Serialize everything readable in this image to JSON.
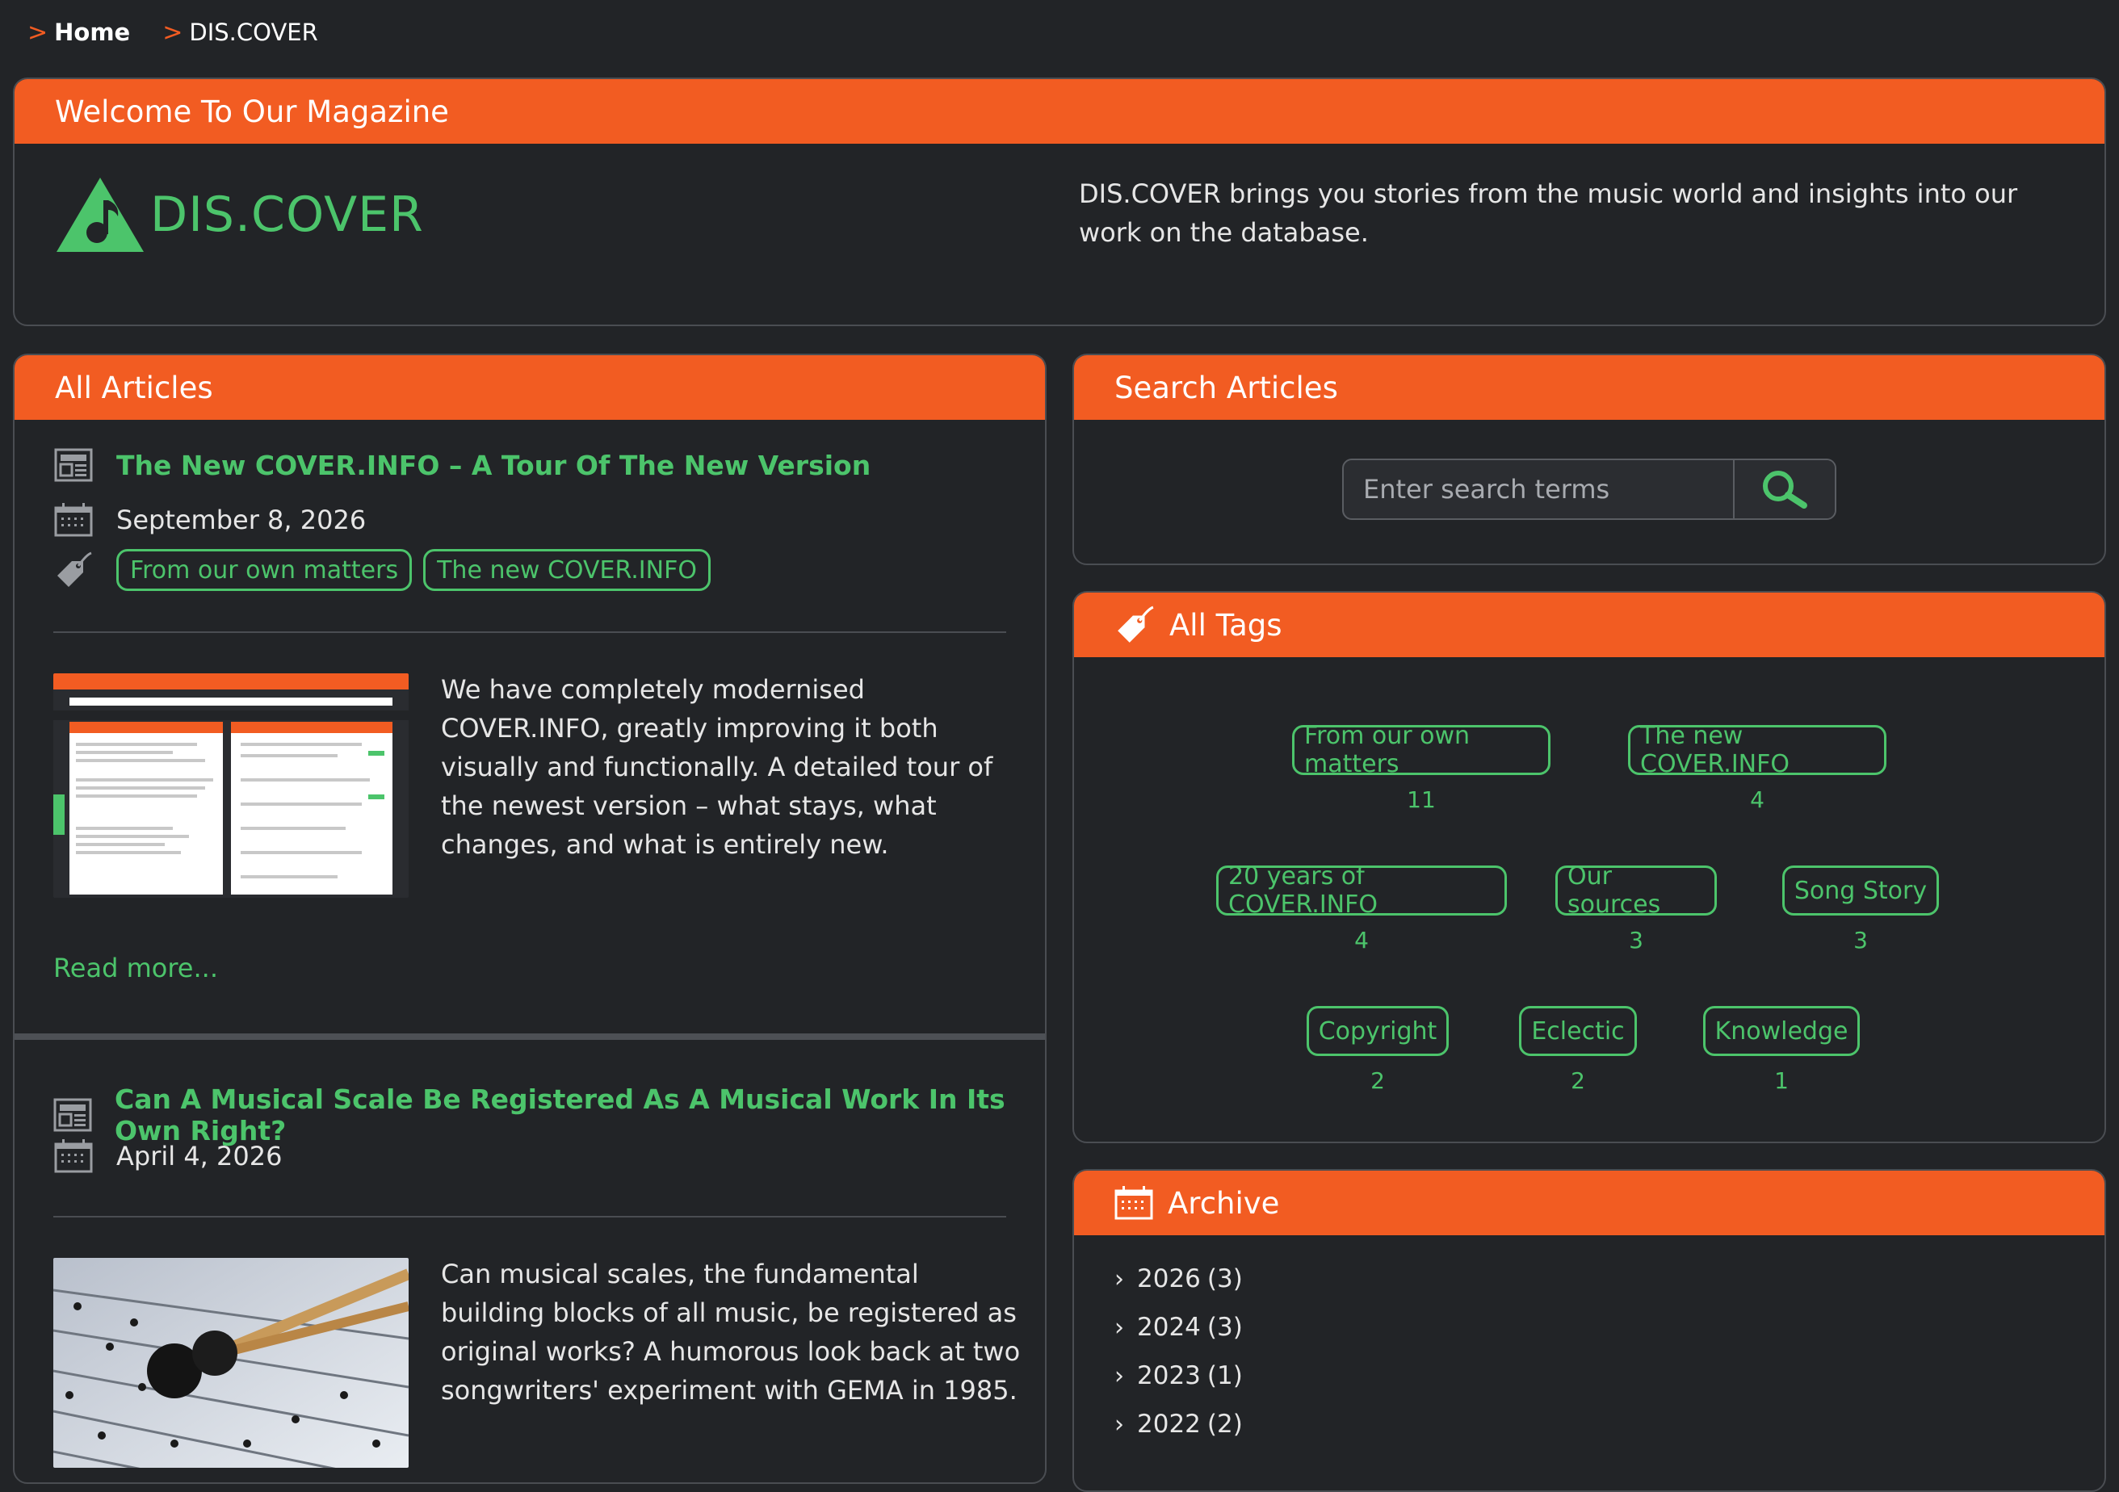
{
  "breadcrumb": {
    "home": "Home",
    "current": "DIS.COVER"
  },
  "welcome": {
    "header": "Welcome To Our Magazine",
    "logo_text": "DIS.COVER",
    "description": "DIS.COVER brings you stories from the music world and insights into our work on the database."
  },
  "articles": {
    "header": "All Articles",
    "items": [
      {
        "title": "The New COVER.INFO – A Tour Of The New Version",
        "date": "September 8, 2026",
        "tags": [
          "From our own matters",
          "The new COVER.INFO"
        ],
        "excerpt": "We have completely modernised COVER.INFO, greatly improving it both visually and functionally. A detailed tour of the newest version – what stays, what changes, and what is entirely new.",
        "read_more": "Read more..."
      },
      {
        "title": "Can A Musical Scale Be Registered As A Musical Work In Its Own Right?",
        "date": "April 4, 2026",
        "excerpt": "Can musical scales, the fundamental building blocks of all music, be registered as original works? A humorous look back at two songwriters' experiment with GEMA in 1985."
      }
    ]
  },
  "search": {
    "header": "Search Articles",
    "placeholder": "Enter search terms"
  },
  "tags": {
    "header": "All Tags",
    "items": [
      {
        "label": "From our own matters",
        "count": "11"
      },
      {
        "label": "The new COVER.INFO",
        "count": "4"
      },
      {
        "label": "20 years of COVER.INFO",
        "count": "4"
      },
      {
        "label": "Our sources",
        "count": "3"
      },
      {
        "label": "Song Story",
        "count": "3"
      },
      {
        "label": "Copyright",
        "count": "2"
      },
      {
        "label": "Eclectic",
        "count": "2"
      },
      {
        "label": "Knowledge",
        "count": "1"
      }
    ]
  },
  "archive": {
    "header": "Archive",
    "items": [
      {
        "year": "2026",
        "count": "(3)"
      },
      {
        "year": "2024",
        "count": "(3)"
      },
      {
        "year": "2023",
        "count": "(1)"
      },
      {
        "year": "2022",
        "count": "(2)"
      }
    ]
  },
  "colors": {
    "accent": "#f25c22",
    "green": "#4cc46b",
    "background": "#222427"
  }
}
